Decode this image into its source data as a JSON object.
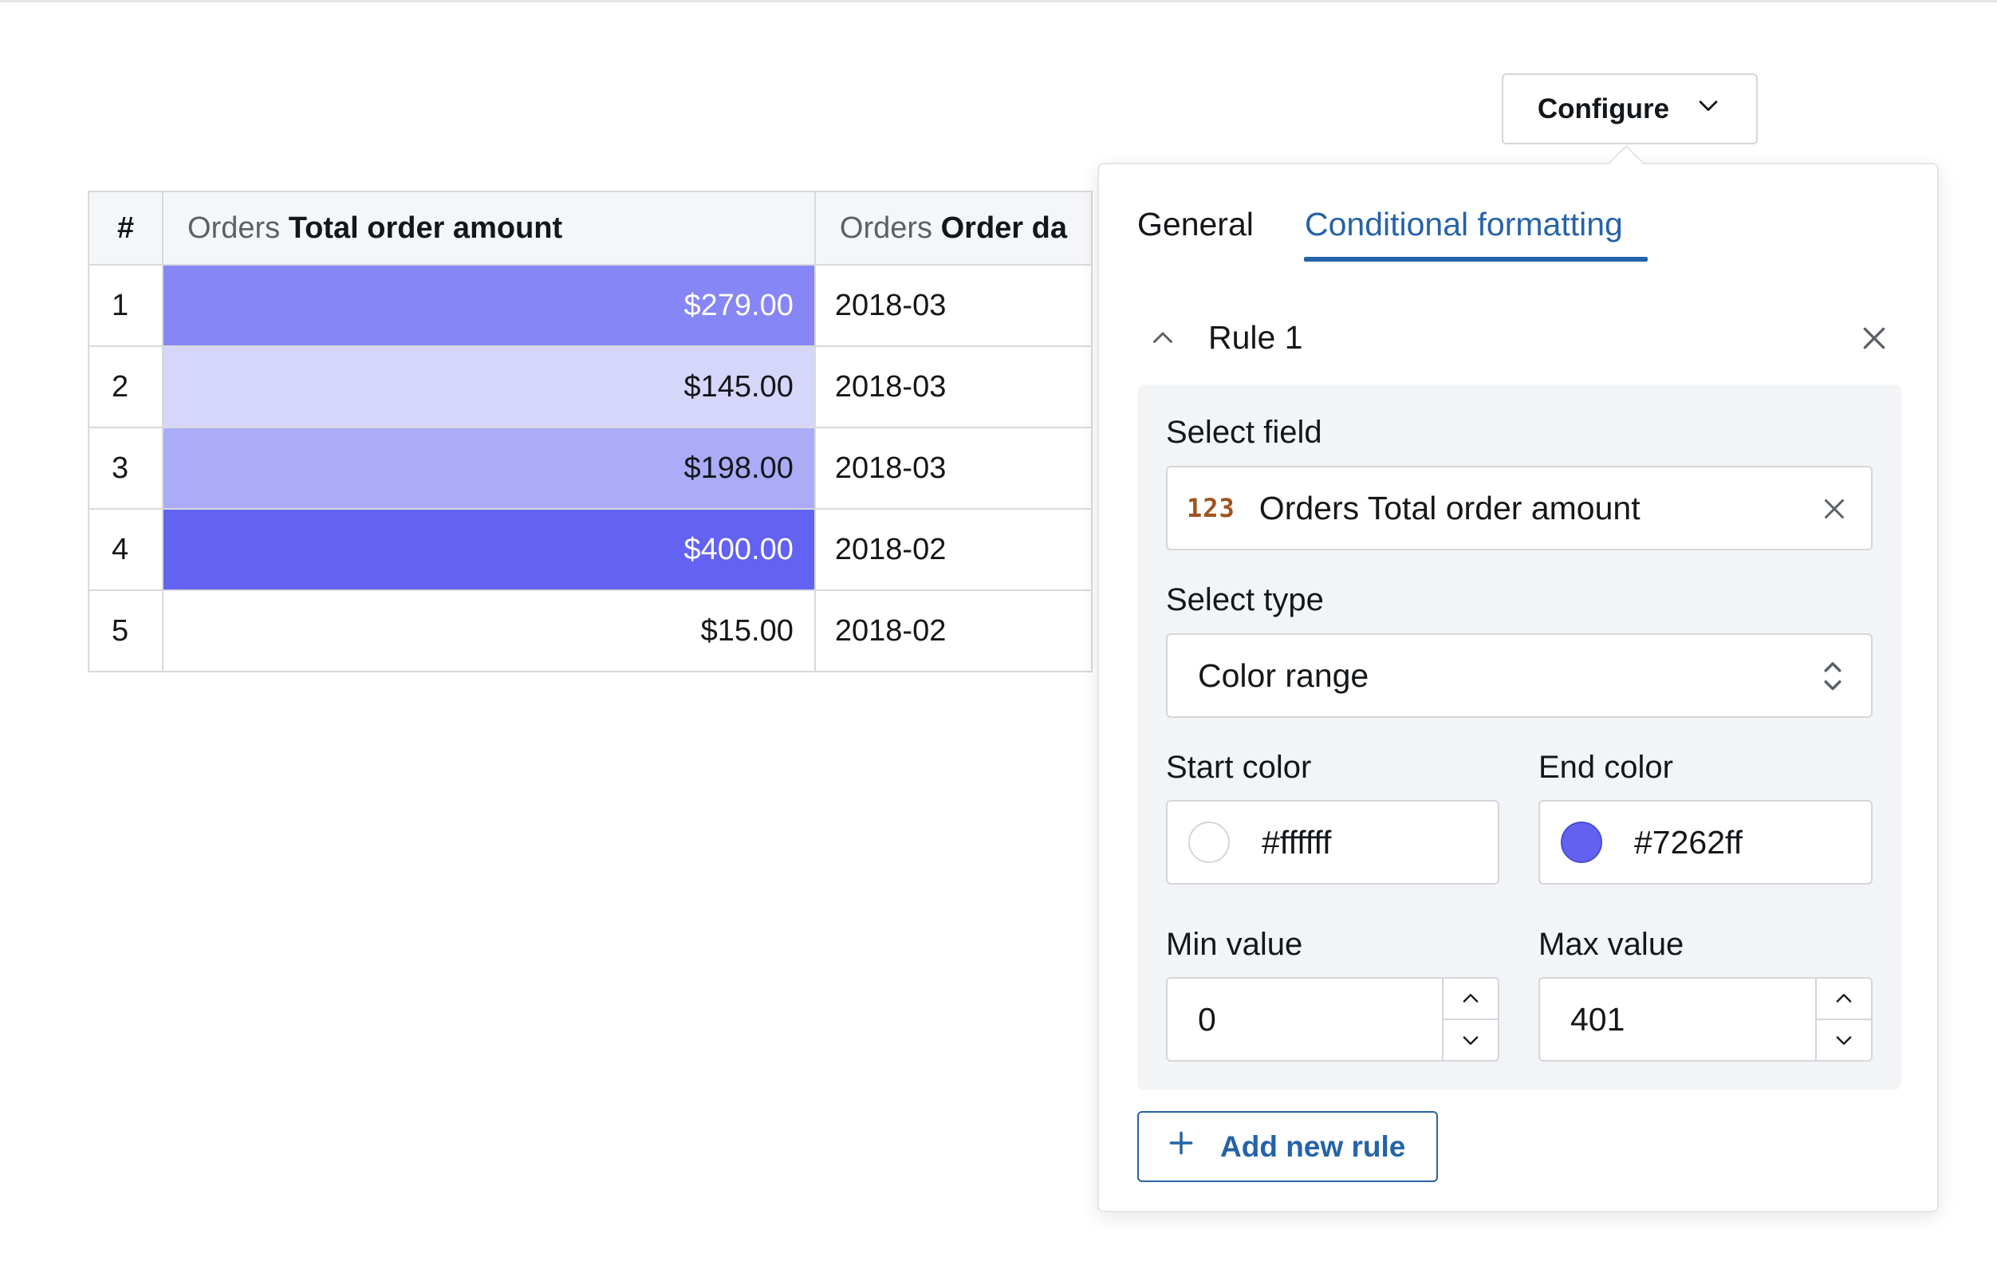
{
  "configure": {
    "label": "Configure",
    "icon": "chevron-down-icon"
  },
  "table": {
    "headers": {
      "index": "#",
      "col1_prefix": "Orders",
      "col1_name": "Total order amount",
      "col2_prefix": "Orders",
      "col2_name": "Order da"
    },
    "rows": [
      {
        "index": "1",
        "amount": "$279.00",
        "date": "2018-03",
        "bg": "#8686f6",
        "fg": "#ffffff"
      },
      {
        "index": "2",
        "amount": "$145.00",
        "date": "2018-03",
        "bg": "#d6d6fb",
        "fg": "#14171a"
      },
      {
        "index": "3",
        "amount": "$198.00",
        "date": "2018-03",
        "bg": "#ababf8",
        "fg": "#14171a"
      },
      {
        "index": "4",
        "amount": "$400.00",
        "date": "2018-02",
        "bg": "#6262f3",
        "fg": "#ffffff"
      },
      {
        "index": "5",
        "amount": "$15.00",
        "date": "2018-02",
        "bg": "#ffffff",
        "fg": "#14171a"
      }
    ]
  },
  "panel": {
    "tabs": {
      "general": "General",
      "conditional": "Conditional formatting"
    },
    "rule": {
      "title": "Rule 1",
      "select_field_label": "Select field",
      "select_field_icon_text": "123",
      "select_field_value": "Orders Total order amount",
      "select_type_label": "Select type",
      "select_type_value": "Color range",
      "start_color_label": "Start color",
      "start_color_value": "#ffffff",
      "end_color_label": "End color",
      "end_color_value": "#7262ff",
      "min_value_label": "Min value",
      "min_value": "0",
      "max_value_label": "Max value",
      "max_value": "401"
    },
    "add_rule_label": "Add new rule"
  },
  "colors": {
    "accent": "#2563a8",
    "range_end": "#7262ff",
    "brand_orange": "#a0531f"
  }
}
